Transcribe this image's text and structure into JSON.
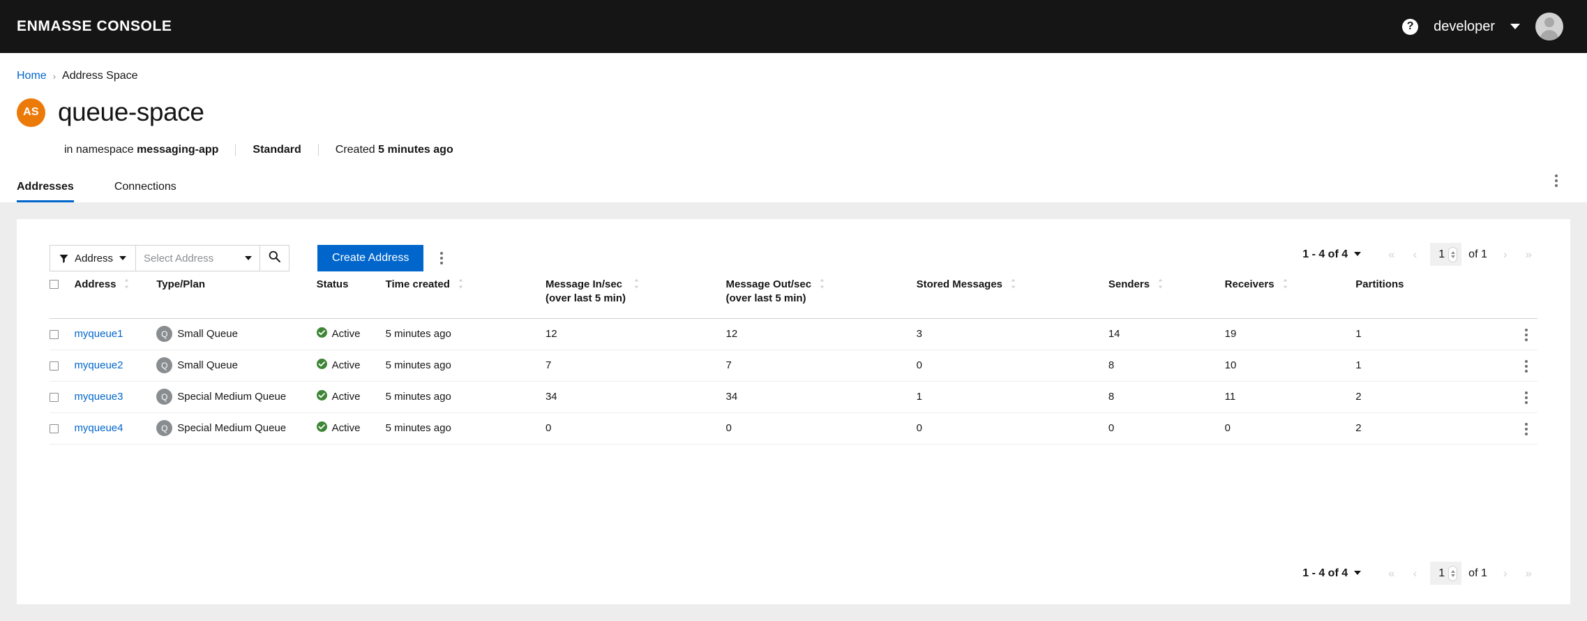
{
  "masthead": {
    "brand": "ENMASSE CONSOLE",
    "help_icon": "help-circle-icon",
    "username": "developer",
    "user_caret": "chevron-down-icon",
    "avatar": "user-avatar"
  },
  "breadcrumb": {
    "home": "Home",
    "separator": "›",
    "current": "Address Space"
  },
  "page_header": {
    "badge": "AS",
    "title": "queue-space",
    "kebab": "kebab-menu-icon",
    "meta": [
      {
        "prefix": "in namespace ",
        "value": "messaging-app",
        "suffix": ""
      },
      {
        "prefix": "",
        "value": "Standard",
        "suffix": ""
      },
      {
        "prefix": "Created ",
        "value": "5 minutes ago",
        "suffix": ""
      }
    ]
  },
  "tabs": [
    {
      "label": "Addresses",
      "active": true
    },
    {
      "label": "Connections",
      "active": false
    }
  ],
  "toolbar": {
    "filter_label": "Address",
    "filter_icon": "filter-funnel-icon",
    "filter_caret": "caret-down-icon",
    "typeahead_placeholder": "Select Address",
    "typeahead_value": "",
    "typeahead_caret": "caret-down-icon",
    "search_icon": "search-icon",
    "create_label": "Create Address",
    "overflow_icon": "kebab-menu-icon"
  },
  "pagination": {
    "count_text": "1 - 4 of 4",
    "count_caret": "caret-down-icon",
    "first_icon": "«",
    "prev_icon": "‹",
    "page_value": "1",
    "of_text": "of 1",
    "next_icon": "›",
    "last_icon": "»"
  },
  "table": {
    "select_all": "select-all-checkbox",
    "columns": [
      {
        "label": "Address",
        "sortable": true
      },
      {
        "label": "Type/Plan",
        "sortable": false
      },
      {
        "label": "Status",
        "sortable": false
      },
      {
        "label": "Time created",
        "sortable": true
      },
      {
        "label": "Message In/sec",
        "sublabel": "(over last 5 min)",
        "sortable": true
      },
      {
        "label": "Message Out/sec",
        "sublabel": "(over last 5 min)",
        "sortable": true
      },
      {
        "label": "Stored Messages",
        "sortable": true
      },
      {
        "label": "Senders",
        "sortable": true
      },
      {
        "label": "Receivers",
        "sortable": true
      },
      {
        "label": "Partitions",
        "sortable": false
      }
    ],
    "rows": [
      {
        "address": "myqueue1",
        "type_badge": "Q",
        "type_plan": "Small Queue",
        "status": "Active",
        "status_icon": "check-circle-icon",
        "time_created": "5 minutes ago",
        "message_in": "12",
        "message_out": "12",
        "stored_messages": "3",
        "senders": "14",
        "receivers": "19",
        "partitions": "1"
      },
      {
        "address": "myqueue2",
        "type_badge": "Q",
        "type_plan": "Small Queue",
        "status": "Active",
        "status_icon": "check-circle-icon",
        "time_created": "5 minutes ago",
        "message_in": "7",
        "message_out": "7",
        "stored_messages": "0",
        "senders": "8",
        "receivers": "10",
        "partitions": "1"
      },
      {
        "address": "myqueue3",
        "type_badge": "Q",
        "type_plan": "Special Medium Queue",
        "status": "Active",
        "status_icon": "check-circle-icon",
        "time_created": "5 minutes ago",
        "message_in": "34",
        "message_out": "34",
        "stored_messages": "1",
        "senders": "8",
        "receivers": "11",
        "partitions": "2"
      },
      {
        "address": "myqueue4",
        "type_badge": "Q",
        "type_plan": "Special Medium Queue",
        "status": "Active",
        "status_icon": "check-circle-icon",
        "time_created": "5 minutes ago",
        "message_in": "0",
        "message_out": "0",
        "stored_messages": "0",
        "senders": "0",
        "receivers": "0",
        "partitions": "2"
      }
    ]
  },
  "colors": {
    "masthead_bg": "#151515",
    "accent_blue": "#0066cc",
    "link_blue": "#06c",
    "badge_orange": "#ec7a08",
    "status_green": "#3e8635",
    "queue_badge_grey": "#8a8d90",
    "page_bg": "#ededed"
  }
}
